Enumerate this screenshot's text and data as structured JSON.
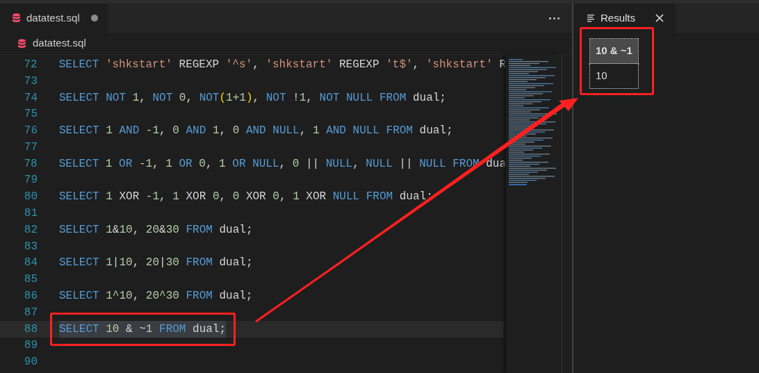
{
  "tab": {
    "label": "datatest.sql",
    "modified": true
  },
  "breadcrumb": {
    "label": "datatest.sql"
  },
  "editor": {
    "lines": [
      {
        "number": "72",
        "selected": false,
        "tokens": [
          {
            "text": "SELECT ",
            "kind": "keyword"
          },
          {
            "text": "'shkstart'",
            "kind": "string"
          },
          {
            "text": " REGEXP ",
            "kind": "plain"
          },
          {
            "text": "'^s'",
            "kind": "string"
          },
          {
            "text": ", ",
            "kind": "plain"
          },
          {
            "text": "'shkstart'",
            "kind": "string"
          },
          {
            "text": " REGEXP ",
            "kind": "plain"
          },
          {
            "text": "'t$'",
            "kind": "string"
          },
          {
            "text": ", ",
            "kind": "plain"
          },
          {
            "text": "'shkstart'",
            "kind": "string"
          },
          {
            "text": " R",
            "kind": "plain"
          }
        ]
      },
      {
        "number": "73",
        "selected": false
      },
      {
        "number": "74",
        "selected": false,
        "tokens": [
          {
            "text": "SELECT NOT ",
            "kind": "keyword"
          },
          {
            "text": "1",
            "kind": "number"
          },
          {
            "text": ", ",
            "kind": "plain"
          },
          {
            "text": "NOT ",
            "kind": "keyword"
          },
          {
            "text": "0",
            "kind": "number"
          },
          {
            "text": ", ",
            "kind": "plain"
          },
          {
            "text": "NOT",
            "kind": "keyword"
          },
          {
            "text": "(",
            "kind": "bracket"
          },
          {
            "text": "1+1",
            "kind": "number"
          },
          {
            "text": ")",
            "kind": "bracket"
          },
          {
            "text": ", ",
            "kind": "plain"
          },
          {
            "text": "NOT ",
            "kind": "keyword"
          },
          {
            "text": "!",
            "kind": "plain"
          },
          {
            "text": "1",
            "kind": "number"
          },
          {
            "text": ", ",
            "kind": "plain"
          },
          {
            "text": "NOT NULL FROM ",
            "kind": "keyword"
          },
          {
            "text": "dual;",
            "kind": "plain"
          }
        ]
      },
      {
        "number": "75",
        "selected": false
      },
      {
        "number": "76",
        "selected": false,
        "tokens": [
          {
            "text": "SELECT ",
            "kind": "keyword"
          },
          {
            "text": "1",
            "kind": "number"
          },
          {
            "text": " AND ",
            "kind": "keyword"
          },
          {
            "text": "-1",
            "kind": "number"
          },
          {
            "text": ", ",
            "kind": "plain"
          },
          {
            "text": "0",
            "kind": "number"
          },
          {
            "text": " AND ",
            "kind": "keyword"
          },
          {
            "text": "1",
            "kind": "number"
          },
          {
            "text": ", ",
            "kind": "plain"
          },
          {
            "text": "0",
            "kind": "number"
          },
          {
            "text": " AND NULL",
            "kind": "keyword"
          },
          {
            "text": ", ",
            "kind": "plain"
          },
          {
            "text": "1",
            "kind": "number"
          },
          {
            "text": " AND NULL FROM ",
            "kind": "keyword"
          },
          {
            "text": "dual;",
            "kind": "plain"
          }
        ]
      },
      {
        "number": "77",
        "selected": false
      },
      {
        "number": "78",
        "selected": false,
        "tokens": [
          {
            "text": "SELECT ",
            "kind": "keyword"
          },
          {
            "text": "1",
            "kind": "number"
          },
          {
            "text": " OR ",
            "kind": "keyword"
          },
          {
            "text": "-1",
            "kind": "number"
          },
          {
            "text": ", ",
            "kind": "plain"
          },
          {
            "text": "1",
            "kind": "number"
          },
          {
            "text": " OR ",
            "kind": "keyword"
          },
          {
            "text": "0",
            "kind": "number"
          },
          {
            "text": ", ",
            "kind": "plain"
          },
          {
            "text": "1",
            "kind": "number"
          },
          {
            "text": " OR NULL",
            "kind": "keyword"
          },
          {
            "text": ", ",
            "kind": "plain"
          },
          {
            "text": "0",
            "kind": "number"
          },
          {
            "text": " || ",
            "kind": "plain"
          },
          {
            "text": "NULL",
            "kind": "keyword"
          },
          {
            "text": ", ",
            "kind": "plain"
          },
          {
            "text": "NULL",
            "kind": "keyword"
          },
          {
            "text": " || ",
            "kind": "plain"
          },
          {
            "text": "NULL FROM ",
            "kind": "keyword"
          },
          {
            "text": "dua",
            "kind": "plain"
          }
        ]
      },
      {
        "number": "79",
        "selected": false
      },
      {
        "number": "80",
        "selected": false,
        "tokens": [
          {
            "text": "SELECT ",
            "kind": "keyword"
          },
          {
            "text": "1",
            "kind": "number"
          },
          {
            "text": " XOR ",
            "kind": "plain"
          },
          {
            "text": "-1",
            "kind": "number"
          },
          {
            "text": ", ",
            "kind": "plain"
          },
          {
            "text": "1",
            "kind": "number"
          },
          {
            "text": " XOR ",
            "kind": "plain"
          },
          {
            "text": "0",
            "kind": "number"
          },
          {
            "text": ", ",
            "kind": "plain"
          },
          {
            "text": "0",
            "kind": "number"
          },
          {
            "text": " XOR ",
            "kind": "plain"
          },
          {
            "text": "0",
            "kind": "number"
          },
          {
            "text": ", ",
            "kind": "plain"
          },
          {
            "text": "1",
            "kind": "number"
          },
          {
            "text": " XOR ",
            "kind": "plain"
          },
          {
            "text": "NULL FROM ",
            "kind": "keyword"
          },
          {
            "text": "dual;",
            "kind": "plain"
          }
        ]
      },
      {
        "number": "81",
        "selected": false
      },
      {
        "number": "82",
        "selected": false,
        "tokens": [
          {
            "text": "SELECT ",
            "kind": "keyword"
          },
          {
            "text": "1",
            "kind": "number"
          },
          {
            "text": "&",
            "kind": "plain"
          },
          {
            "text": "10",
            "kind": "number"
          },
          {
            "text": ", ",
            "kind": "plain"
          },
          {
            "text": "20",
            "kind": "number"
          },
          {
            "text": "&",
            "kind": "plain"
          },
          {
            "text": "30",
            "kind": "number"
          },
          {
            "text": " FROM ",
            "kind": "keyword"
          },
          {
            "text": "dual;",
            "kind": "plain"
          }
        ]
      },
      {
        "number": "83",
        "selected": false
      },
      {
        "number": "84",
        "selected": false,
        "tokens": [
          {
            "text": "SELECT ",
            "kind": "keyword"
          },
          {
            "text": "1",
            "kind": "number"
          },
          {
            "text": "|",
            "kind": "plain"
          },
          {
            "text": "10",
            "kind": "number"
          },
          {
            "text": ", ",
            "kind": "plain"
          },
          {
            "text": "20",
            "kind": "number"
          },
          {
            "text": "|",
            "kind": "plain"
          },
          {
            "text": "30",
            "kind": "number"
          },
          {
            "text": " FROM ",
            "kind": "keyword"
          },
          {
            "text": "dual;",
            "kind": "plain"
          }
        ]
      },
      {
        "number": "85",
        "selected": false
      },
      {
        "number": "86",
        "selected": false,
        "tokens": [
          {
            "text": "SELECT ",
            "kind": "keyword"
          },
          {
            "text": "1^10",
            "kind": "number"
          },
          {
            "text": ", ",
            "kind": "plain"
          },
          {
            "text": "20^30",
            "kind": "number"
          },
          {
            "text": " FROM ",
            "kind": "keyword"
          },
          {
            "text": "dual;",
            "kind": "plain"
          }
        ]
      },
      {
        "number": "87",
        "selected": false
      },
      {
        "number": "88",
        "selected": true,
        "tokens": [
          {
            "text": "SELECT ",
            "kind": "keyword"
          },
          {
            "text": "10",
            "kind": "number"
          },
          {
            "text": " & ~",
            "kind": "plain"
          },
          {
            "text": "1",
            "kind": "number"
          },
          {
            "text": " FROM ",
            "kind": "keyword"
          },
          {
            "text": "dual;",
            "kind": "plain"
          }
        ]
      },
      {
        "number": "89",
        "selected": false
      },
      {
        "number": "90",
        "selected": false
      }
    ]
  },
  "results": {
    "title": "Results",
    "columns": [
      "10 & ~1"
    ],
    "rows": [
      [
        "10"
      ]
    ]
  }
}
